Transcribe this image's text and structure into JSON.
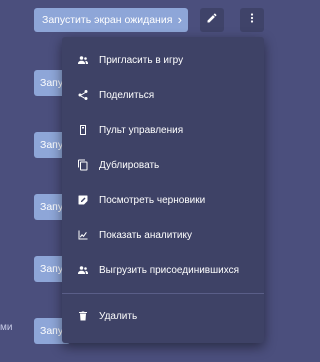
{
  "top_button": {
    "label": "Запустить экран ожидания",
    "chevron": "›"
  },
  "row_buttons": [
    "Запу",
    "Запу",
    "Запу",
    "Запу",
    "Запу"
  ],
  "left_text": "ми",
  "menu": {
    "items": [
      {
        "label": "Пригласить в игру",
        "icon": "people-icon"
      },
      {
        "label": "Поделиться",
        "icon": "share-icon"
      },
      {
        "label": "Пульт управления",
        "icon": "remote-icon"
      },
      {
        "label": "Дублировать",
        "icon": "copy-icon"
      },
      {
        "label": "Посмотреть черновики",
        "icon": "drafts-icon"
      },
      {
        "label": "Показать аналитику",
        "icon": "analytics-icon"
      },
      {
        "label": "Выгрузить присоединившихся",
        "icon": "people-icon"
      }
    ],
    "delete_label": "Удалить",
    "delete_icon": "trash-icon"
  },
  "colors": {
    "background": "#4b4f7d",
    "menu_bg": "#3e4266",
    "button_blue": "#8ea6d8",
    "text": "#ffffff"
  }
}
